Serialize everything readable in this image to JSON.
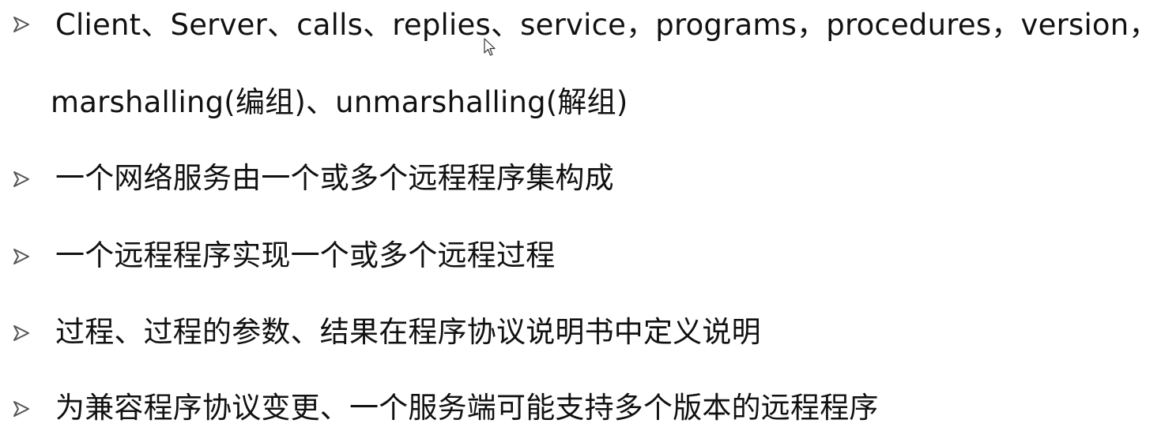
{
  "bullets": [
    {
      "line1": "Client、Server、calls、replies、service，programs，procedures，version，",
      "line2": "marshalling(编组)、unmarshalling(解组)"
    },
    {
      "text": "一个网络服务由一个或多个远程程序集构成"
    },
    {
      "text": " 一个远程程序实现一个或多个远程过程"
    },
    {
      "text": "过程、过程的参数、结果在程序协议说明书中定义说明"
    },
    {
      "text": "为兼容程序协议变更、一个服务端可能支持多个版本的远程程序"
    }
  ],
  "icons": {
    "bullet": "arrow-bullet-icon",
    "cursor": "mouse-pointer-icon"
  },
  "colors": {
    "text": "#111111",
    "bullet_fill": "#ffffff",
    "bullet_stroke": "#555555"
  }
}
